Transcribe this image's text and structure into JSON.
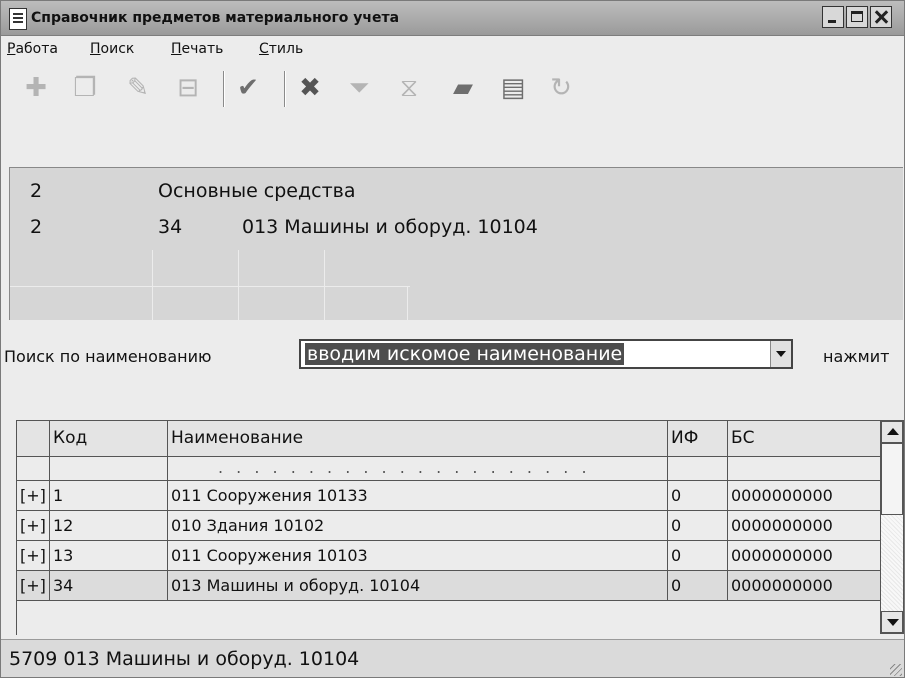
{
  "window": {
    "title": "Справочник предметов материального учета"
  },
  "menu": {
    "items": [
      "Работа",
      "Поиск",
      "Печать",
      "Стиль"
    ]
  },
  "toolbar": {
    "buttons": [
      {
        "icon": "add-row-icon",
        "glyph": "✚"
      },
      {
        "icon": "copy-icon",
        "glyph": "❐"
      },
      {
        "icon": "edit-icon",
        "glyph": "✎"
      },
      {
        "icon": "delete-row-icon",
        "glyph": "⊟"
      },
      {
        "icon": "checkmark-icon",
        "glyph": "✔"
      },
      {
        "icon": "cancel-icon",
        "glyph": "✖"
      },
      {
        "icon": "filter-icon",
        "glyph": "⏷"
      },
      {
        "icon": "clear-filter-icon",
        "glyph": "⧖"
      },
      {
        "icon": "folder-icon",
        "glyph": "▰"
      },
      {
        "icon": "print-icon",
        "glyph": "▤"
      },
      {
        "icon": "refresh-icon",
        "glyph": "↻"
      }
    ]
  },
  "info_panel": {
    "row1": {
      "level": "2",
      "name": "Основные средства"
    },
    "row2": {
      "level": "2",
      "code": "34",
      "name": "013 Машины и оборуд. 10104"
    }
  },
  "search": {
    "label": "Поиск по наименованию",
    "value": "вводим искомое наименование",
    "hint": "нажмит"
  },
  "grid": {
    "columns": [
      "Код",
      "Наименование",
      "ИФ",
      "БС"
    ],
    "dots_row": ". . . . . . . . . . . . . . . . . . . . .",
    "rows": [
      {
        "expand": "[+]",
        "code": "1",
        "name": "011 Сооружения 10133",
        "if": "0",
        "bs": "0000000000"
      },
      {
        "expand": "[+]",
        "code": "12",
        "name": "010 Здания 10102",
        "if": "0",
        "bs": "0000000000"
      },
      {
        "expand": "[+]",
        "code": "13",
        "name": "011 Сооружения 10103",
        "if": "0",
        "bs": "0000000000"
      },
      {
        "expand": "[+]",
        "code": "34",
        "name": "013 Машины и оборуд. 10104",
        "if": "0",
        "bs": "0000000000"
      }
    ]
  },
  "statusbar": {
    "text": "5709 013 Машины и оборуд. 10104"
  }
}
